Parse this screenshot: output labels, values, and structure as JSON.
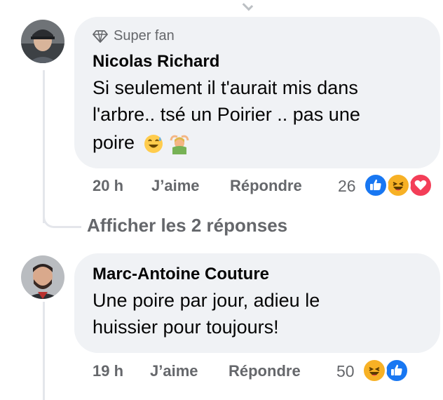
{
  "comments": [
    {
      "badge": "Super fan",
      "author": "Nicolas Richard",
      "text_lines": [
        "Si seulement il t'aurait mis dans",
        "l'arbre.. tsé un Poirier .. pas une",
        "poire"
      ],
      "text_emojis": [
        "sweat-smile-emoji",
        "person-gesturing-ok-emoji"
      ],
      "time": "20 h",
      "like_label": "J’aime",
      "reply_label": "Répondre",
      "reaction_count": "26",
      "reactions": [
        "like-icon",
        "haha-icon",
        "love-icon"
      ]
    },
    {
      "author": "Marc-Antoine Couture",
      "text_lines": [
        "Une poire par jour, adieu le",
        "huissier pour toujours!"
      ],
      "time": "19 h",
      "like_label": "J’aime",
      "reply_label": "Répondre",
      "reaction_count": "50",
      "reactions": [
        "haha-icon",
        "like-icon"
      ]
    }
  ],
  "replies_link": "Afficher les 2 réponses",
  "colors": {
    "bubble": "#f0f2f5",
    "meta_text": "#65676b",
    "like_blue": "#1877f2",
    "love_red": "#f33e58",
    "haha_yellow": "#f7b125"
  }
}
